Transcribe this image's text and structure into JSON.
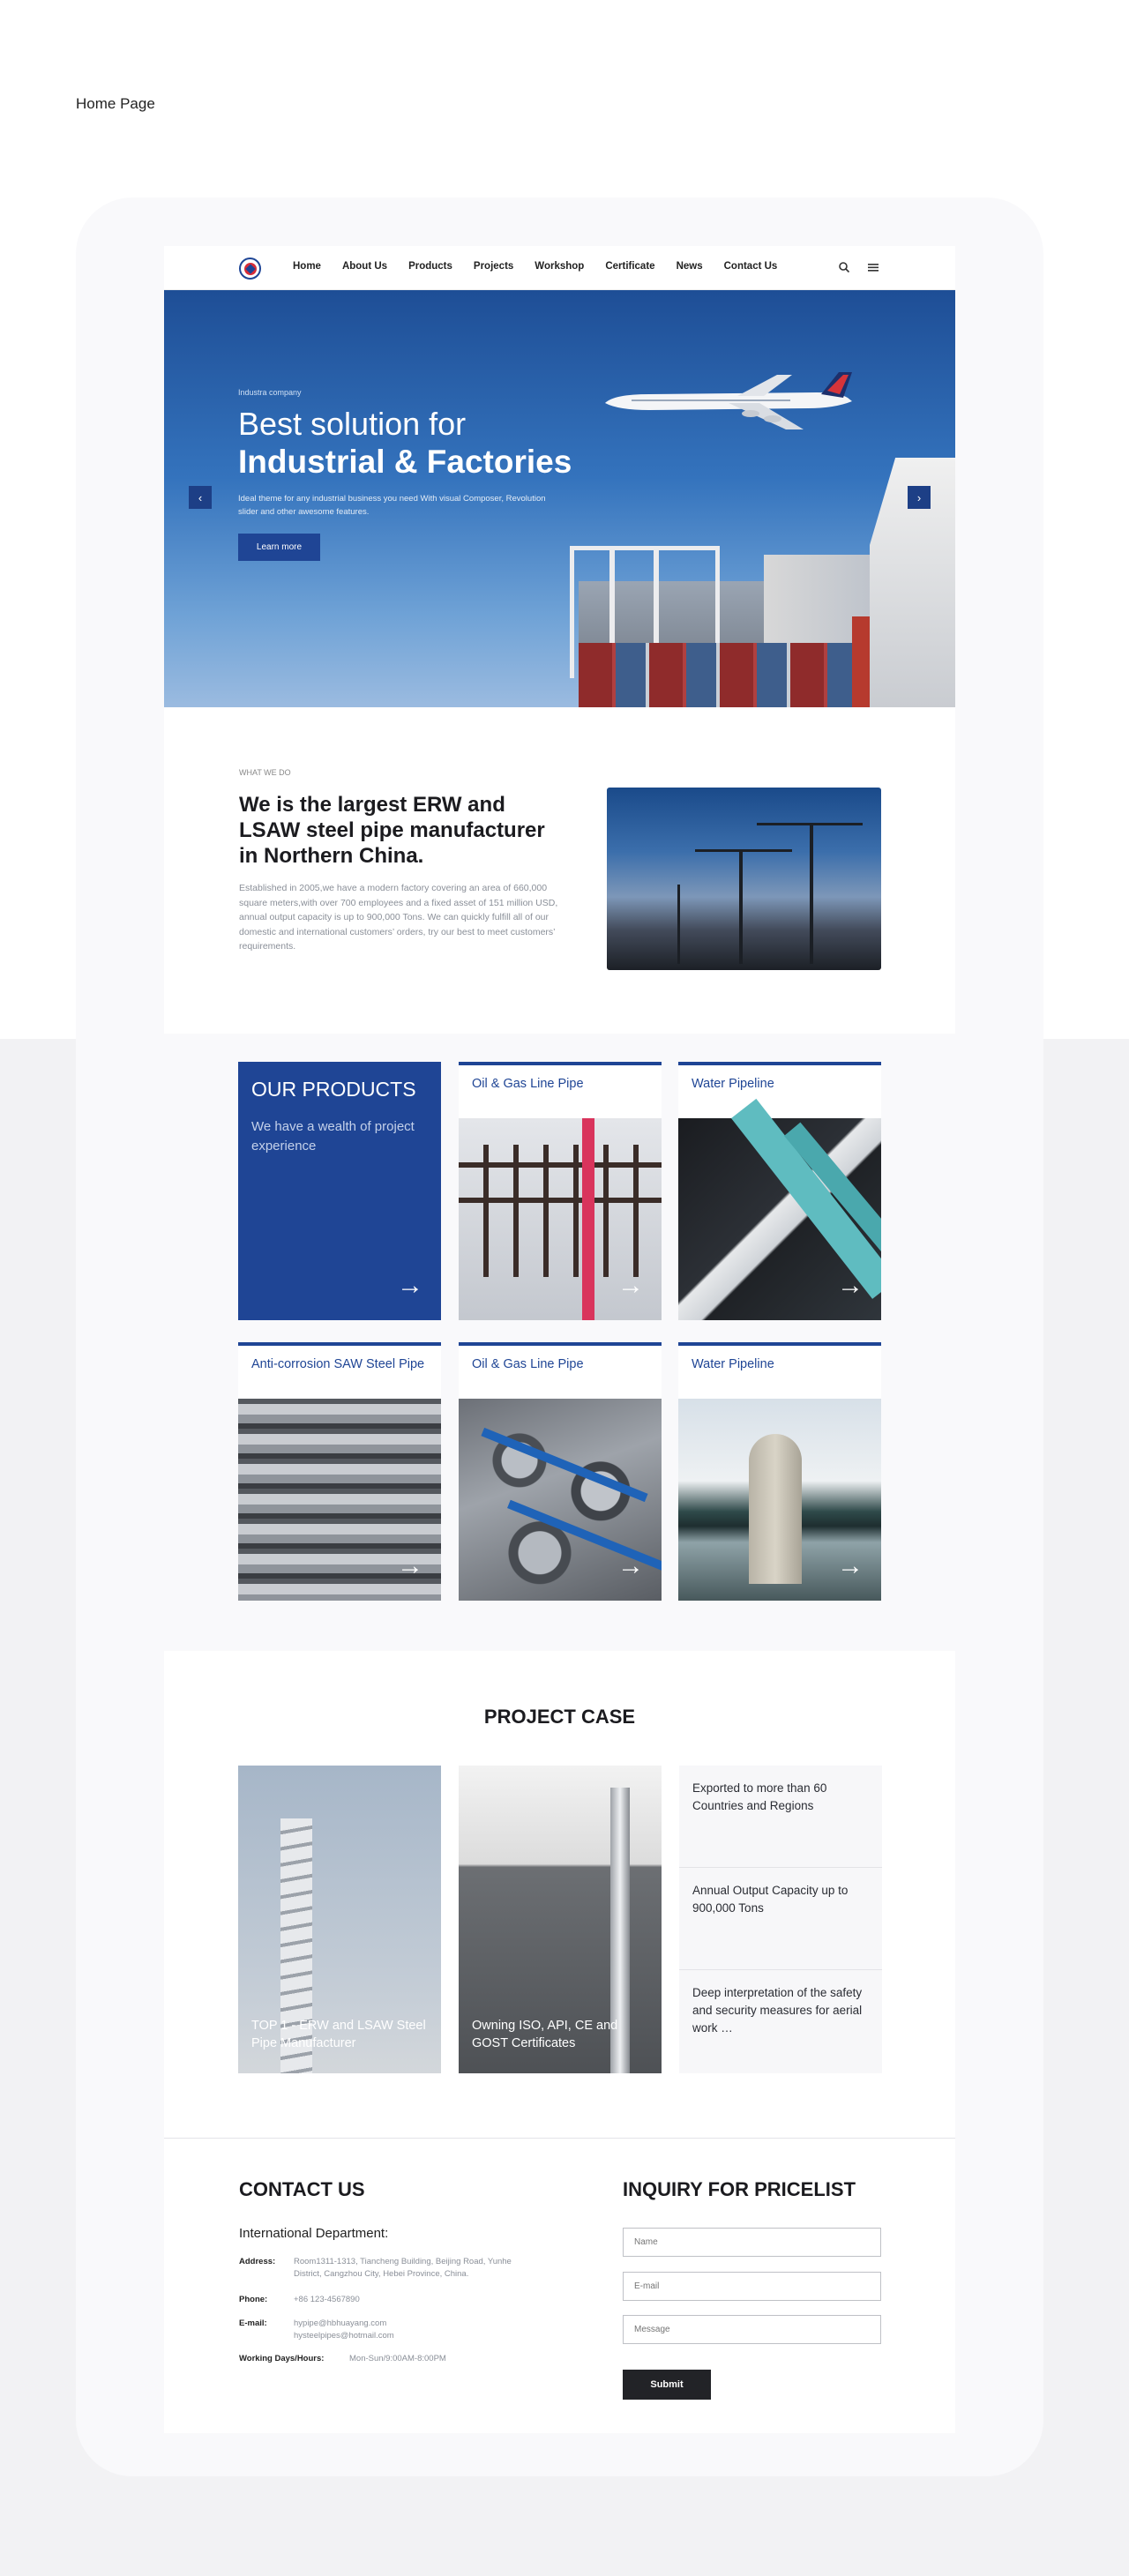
{
  "page_label": "Home Page",
  "nav": {
    "items": [
      "Home",
      "About Us",
      "Products",
      "Projects",
      "Workshop",
      "Certificate",
      "News",
      "Contact Us"
    ]
  },
  "hero": {
    "eyebrow": "Industra company",
    "title_line1": "Best solution for",
    "title_line2": "Industrial & Factories",
    "description": "Ideal theme for any industrial business you need With visual Composer, Revolution slider and other awesome features.",
    "button": "Learn more",
    "prev": "‹",
    "next": "›"
  },
  "about": {
    "eyebrow": "WHAT WE DO",
    "title": "We is the largest ERW and LSAW steel pipe manufacturer in Northern China.",
    "text": "Established in 2005,we have a modern factory covering an area of 660,000 square meters,with over 700 employees and a fixed asset of 151 million USD, annual output capacity is up to 900,000 Tons. We can quickly fulfill all of our domestic and international customers’ orders, try our best to meet customers’ requirements."
  },
  "products": {
    "feature_title": "OUR PRODUCTS",
    "feature_desc": "We have a wealth of project experience",
    "arrow": "→",
    "items": [
      {
        "label": "Oil & Gas Line Pipe"
      },
      {
        "label": "Water Pipeline"
      },
      {
        "label": "Anti-corrosion SAW Steel Pipe"
      },
      {
        "label": "Oil & Gas Line Pipe"
      },
      {
        "label": "Water Pipeline"
      }
    ]
  },
  "project_case": {
    "title": "PROJECT CASE",
    "cards": [
      {
        "caption": "TOP 1 - ERW and LSAW Steel Pipe Manufacturer"
      },
      {
        "caption": "Owning ISO, API, CE and GOST Certificates"
      }
    ],
    "stats": [
      "Exported to more than 60 Countries and Regions",
      "Annual Output Capacity up to 900,000 Tons",
      "Deep interpretation of the safety and security measures for aerial work …"
    ]
  },
  "contact": {
    "title": "CONTACT US",
    "department": "International Department:",
    "address_label": "Address:",
    "address_line1": "Room1311-1313, Tiancheng Building, Beijing Road, Yunhe",
    "address_line2": "District, Cangzhou City, Hebei Province, China.",
    "phone_label": "Phone:",
    "phone": "+86 123-4567890",
    "email_label": "E-mail:",
    "email1": "hypipe@hbhuayang.com",
    "email2": "hysteelpipes@hotmail.com",
    "hours_label": "Working Days/Hours:",
    "hours": "Mon-Sun/9:00AM-8:00PM"
  },
  "inquiry": {
    "title": "INQUIRY FOR PRICELIST",
    "name_placeholder": "Name",
    "email_placeholder": "E-mail",
    "message_placeholder": "Message",
    "submit": "Submit"
  },
  "colors": {
    "brand_blue": "#1f4595",
    "dark": "#222327"
  },
  "icons": [
    "logo",
    "search-icon",
    "menu-icon",
    "chevron-left-icon",
    "chevron-right-icon",
    "arrow-right-icon"
  ]
}
